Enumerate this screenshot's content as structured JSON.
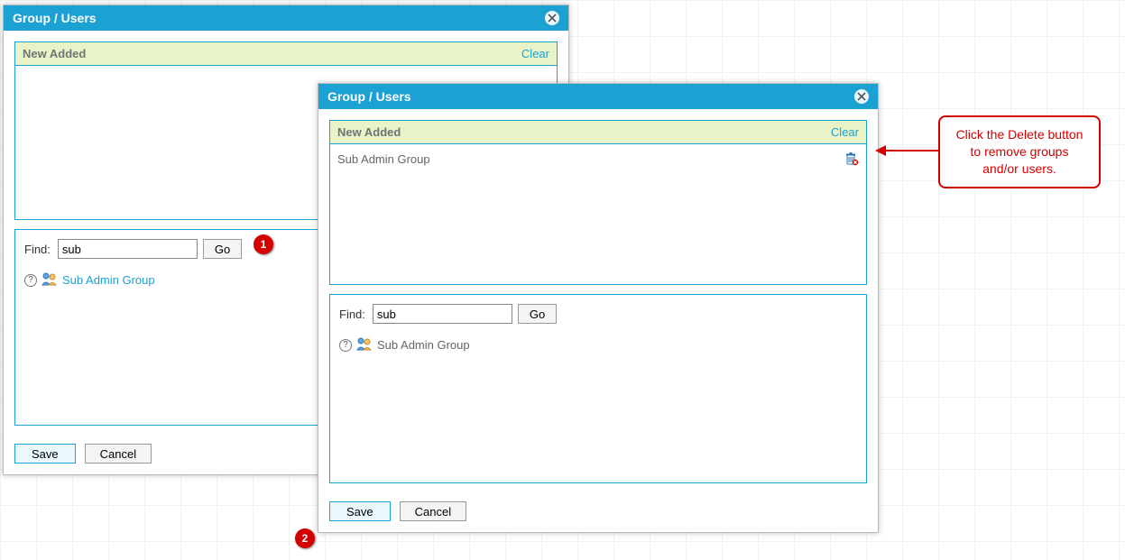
{
  "dialog1": {
    "title": "Group / Users",
    "pane_header": "New Added",
    "clear": "Clear",
    "find_label": "Find:",
    "find_value": "sub",
    "go_label": "Go",
    "results": [
      {
        "name": "Sub Admin Group",
        "link": true
      }
    ],
    "save": "Save",
    "cancel": "Cancel"
  },
  "dialog2": {
    "title": "Group / Users",
    "pane_header": "New Added",
    "clear": "Clear",
    "added": [
      {
        "name": "Sub Admin Group"
      }
    ],
    "find_label": "Find:",
    "find_value": "sub",
    "go_label": "Go",
    "results": [
      {
        "name": "Sub Admin Group",
        "link": false
      }
    ],
    "save": "Save",
    "cancel": "Cancel"
  },
  "annotations": {
    "marker1": "1",
    "marker2": "2",
    "callout": "Click the Delete button to remove groups and/or users."
  }
}
